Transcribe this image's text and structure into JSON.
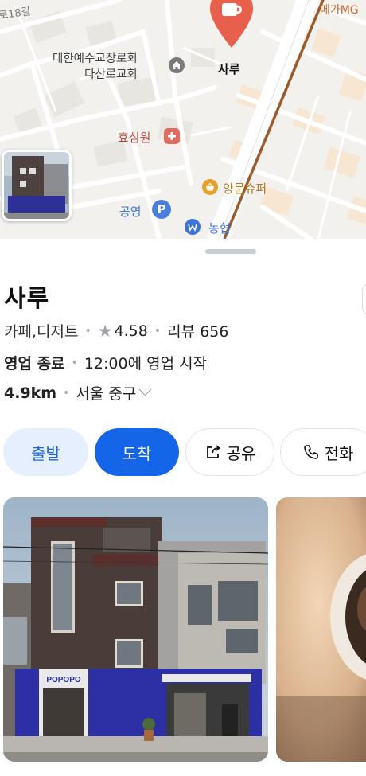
{
  "map": {
    "labels": {
      "street": "로18길",
      "church_line1": "대한예수교장로회",
      "church_line2": "다산로교회",
      "place_marker": "사루",
      "hospital": "효심원",
      "supermarket": "양문슈퍼",
      "parking": "공영",
      "bank": "농협",
      "cafe_edge": "메가MG"
    },
    "icons": {
      "church": "church-icon",
      "hospital": "hospital-cross-icon",
      "supermarket": "shopping-basket-icon",
      "parking": "parking-icon",
      "bank": "bank-icon",
      "pin": "cafe-pin-icon"
    },
    "parking_glyph": "P",
    "colors": {
      "pin": "#e8604c",
      "route": "#9b5a2a"
    }
  },
  "place": {
    "name": "사루",
    "category": "카페,디저트",
    "rating": "4.58",
    "review_label": "리뷰 656",
    "status": "영업 종료",
    "hours": "12:00에 영업 시작",
    "distance": "4.9km",
    "area": "서울 중구"
  },
  "actions": {
    "depart": "출발",
    "arrive": "도착",
    "share": "공유",
    "call": "전화"
  },
  "photos": {
    "sign_text": "POPOPO"
  },
  "colors": {
    "primary": "#1565e9",
    "primary_light": "#e6effd"
  }
}
